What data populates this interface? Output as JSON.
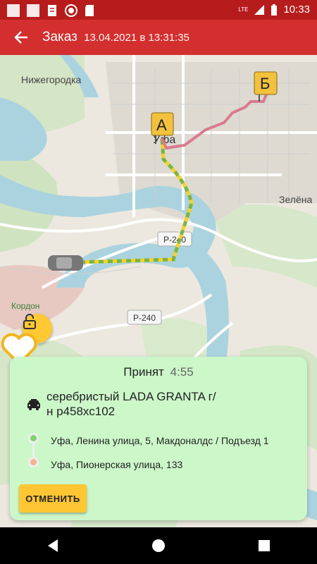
{
  "status_bar": {
    "time": "10:33",
    "lte": "LTE"
  },
  "app_bar": {
    "title": "Заказ",
    "subtitle": "13.04.2021 в 13:31:35"
  },
  "map": {
    "labels": {
      "nizhegorodka": "Нижегородка",
      "ufa": "Уфа",
      "zelyonaya": "Зелёна",
      "kordon": "Кордон",
      "road1": "Р-240",
      "road2": "Р-240"
    },
    "markers": {
      "a": "А",
      "b": "Б"
    }
  },
  "order": {
    "status": "Принят",
    "timer": "4:55",
    "car_line1": "серебристый LADA GRANTA г/",
    "car_line2": "н р458хс102",
    "from": "Уфа, Ленина улица, 5, Макдоналдс / Подъезд 1",
    "to": "Уфа, Пионерская улица, 133",
    "cancel_label": "ОТМЕНИТЬ"
  },
  "colors": {
    "status_bar": "#b71c1c",
    "app_bar": "#d32f2f",
    "card": "#ccf7c9",
    "accent": "#ffc633"
  },
  "icons": [
    "back-arrow-icon",
    "lock-icon",
    "heart-icon",
    "taxi-icon",
    "back-nav-icon",
    "home-nav-icon",
    "recents-nav-icon"
  ]
}
